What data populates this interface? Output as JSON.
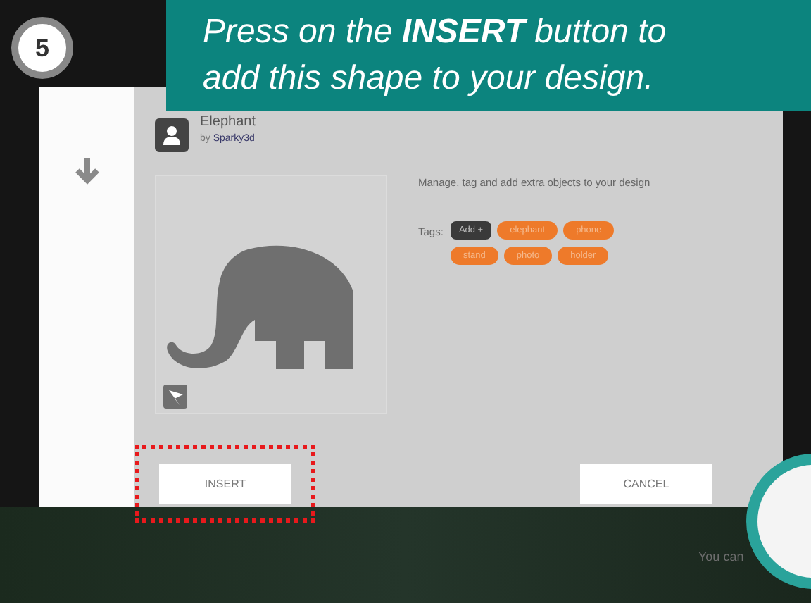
{
  "step": {
    "number": "5"
  },
  "callout": {
    "lines": [
      "Press on the **INSERT** button to",
      "add this shape to your design."
    ]
  },
  "dialog": {
    "title": "Elephant",
    "byline": {
      "prefix": "by",
      "author": "Sparky3d"
    },
    "description": "Manage, tag and add extra objects to your design",
    "tags_label": "Tags:",
    "add_tag": "Add +",
    "tags": [
      "elephant",
      "phone",
      "stand",
      "photo",
      "holder"
    ],
    "buttons": [
      {
        "label": "INSERT",
        "highlighted": true
      },
      {
        "label": "CANCEL",
        "highlighted": false
      }
    ]
  },
  "background": {
    "hint": "You can"
  }
}
